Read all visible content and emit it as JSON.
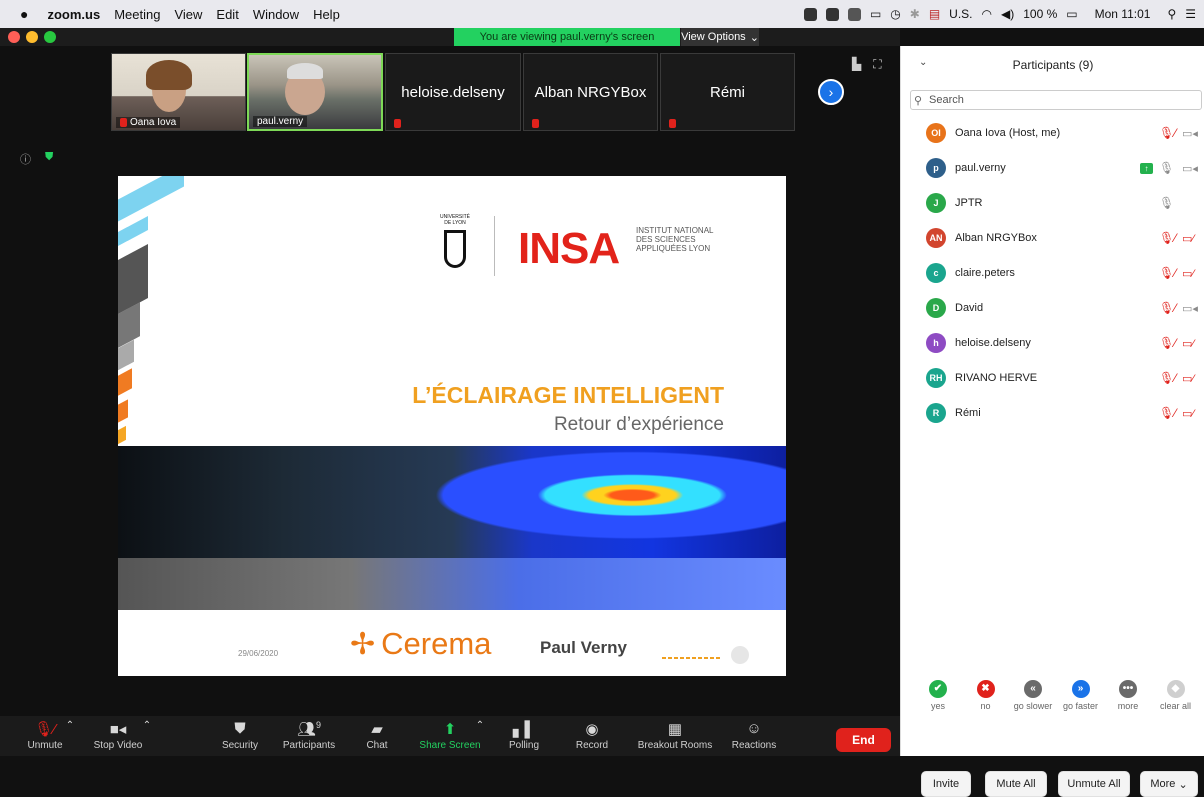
{
  "menubar": {
    "apple": "",
    "app": "zoom.us",
    "items": [
      "Meeting",
      "View",
      "Edit",
      "Window",
      "Help"
    ],
    "input_source": "U.S.",
    "battery": "100 %",
    "clock": "Mon 11:01"
  },
  "banner": {
    "viewing": "You are viewing paul.verny's screen",
    "view_options": "View Options"
  },
  "thumbnails": [
    {
      "name": "Oana Iova",
      "type": "video"
    },
    {
      "name": "paul.verny",
      "type": "video"
    },
    {
      "name": "heloise.delseny",
      "type": "name"
    },
    {
      "name": "Alban NRGYBox",
      "type": "name"
    },
    {
      "name": "Rémi",
      "type": "name"
    }
  ],
  "slide": {
    "univ_text": "UNIVERSITÉ DE LYON",
    "insa": "INSA",
    "insa_sub": "INSTITUT NATIONAL DES SCIENCES APPLIQUÉES LYON",
    "title": "L’ÉCLAIRAGE INTELLIGENT",
    "subtitle": "Retour d’expérience",
    "date": "29/06/2020",
    "cerema": "Cerema",
    "presenter": "Paul Verny"
  },
  "toolbar": {
    "unmute": "Unmute",
    "stop_video": "Stop Video",
    "security": "Security",
    "participants": "Participants",
    "participants_count": "9",
    "chat": "Chat",
    "share_screen": "Share Screen",
    "polling": "Polling",
    "record": "Record",
    "breakout": "Breakout Rooms",
    "reactions": "Reactions",
    "end": "End"
  },
  "panel": {
    "title": "Participants (9)",
    "search_placeholder": "Search",
    "participants": [
      {
        "initials": "OI",
        "name": "Oana Iova (Host, me)",
        "color": "#e8731a",
        "mic": "off",
        "cam": "on"
      },
      {
        "initials": "p",
        "name": "paul.verny",
        "color": "#2e5f8a",
        "mic": "on",
        "cam": "on",
        "sharing": true
      },
      {
        "initials": "J",
        "name": "JPTR",
        "color": "#2aa84a",
        "mic": "on",
        "cam": "none"
      },
      {
        "initials": "AN",
        "name": "Alban NRGYBox",
        "color": "#d2452e",
        "mic": "off",
        "cam": "off"
      },
      {
        "initials": "c",
        "name": "claire.peters",
        "color": "#1aa58e",
        "mic": "off",
        "cam": "off"
      },
      {
        "initials": "D",
        "name": "David",
        "color": "#2aa84a",
        "mic": "off",
        "cam": "on"
      },
      {
        "initials": "h",
        "name": "heloise.delseny",
        "color": "#8e4bc3",
        "mic": "off",
        "cam": "off"
      },
      {
        "initials": "RH",
        "name": "RIVANO HERVE",
        "color": "#1aa58e",
        "mic": "off",
        "cam": "off"
      },
      {
        "initials": "R",
        "name": "Rémi",
        "color": "#1aa58e",
        "mic": "off",
        "cam": "off"
      }
    ],
    "feedback": [
      {
        "label": "yes",
        "color": "#23b14d",
        "glyph": "✔"
      },
      {
        "label": "no",
        "color": "#e0221c",
        "glyph": "✖"
      },
      {
        "label": "go slower",
        "color": "#6a6a6a",
        "glyph": "«"
      },
      {
        "label": "go faster",
        "color": "#1a73e8",
        "glyph": "»"
      },
      {
        "label": "more",
        "color": "#6a6a6a",
        "glyph": "•••"
      },
      {
        "label": "clear all",
        "color": "#cfcfcf",
        "glyph": "◆"
      }
    ],
    "invite": "Invite",
    "mute_all": "Mute All",
    "unmute_all": "Unmute All",
    "more": "More"
  }
}
